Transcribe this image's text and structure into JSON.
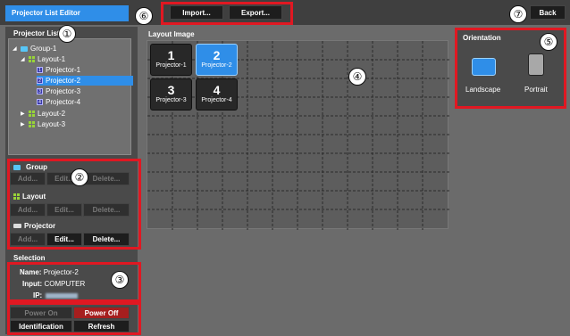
{
  "app": {
    "title": "Projector List Editor"
  },
  "header": {
    "import_label": "Import...",
    "export_label": "Export...",
    "back_label": "Back"
  },
  "markers": {
    "one": "①",
    "two": "②",
    "three": "③",
    "four": "④",
    "five": "⑤",
    "six": "⑥",
    "seven": "⑦"
  },
  "left": {
    "projector_list_title": "Projector List",
    "tree": {
      "group": "Group-1",
      "layout1": "Layout-1",
      "proj1": "Projector-1",
      "proj2": "Projector-2",
      "proj3": "Projector-3",
      "proj4": "Projector-4",
      "layout2": "Layout-2",
      "layout3": "Layout-3",
      "proj1_num": "1",
      "proj2_num": "2",
      "proj3_num": "3",
      "proj4_num": "4"
    },
    "group": {
      "title": "Group",
      "add": "Add...",
      "edit": "Edit...",
      "delete": "Delete..."
    },
    "layout": {
      "title": "Layout",
      "add": "Add...",
      "edit": "Edit...",
      "delete": "Delete..."
    },
    "projector": {
      "title": "Projector",
      "add": "Add...",
      "edit": "Edit...",
      "delete": "Delete..."
    },
    "selection": {
      "title": "Selection",
      "name_key": "Name:",
      "name_val": "Projector-2",
      "input_key": "Input:",
      "input_val": "COMPUTER",
      "ip_key": "IP:"
    },
    "power": {
      "on": "Power On",
      "off": "Power Off",
      "identification": "Identification",
      "refresh": "Refresh"
    }
  },
  "layout_image": {
    "title": "Layout Image",
    "tiles": [
      {
        "number": "1",
        "label": "Projector-1"
      },
      {
        "number": "2",
        "label": "Projector-2"
      },
      {
        "number": "3",
        "label": "Projector-3"
      },
      {
        "number": "4",
        "label": "Projector-4"
      }
    ]
  },
  "orientation": {
    "title": "Orientation",
    "landscape": "Landscape",
    "portrait": "Portrait"
  },
  "colors": {
    "accent": "#2f8ee8",
    "annotation_red": "#e01822",
    "power_off_red": "#a61e1e"
  }
}
